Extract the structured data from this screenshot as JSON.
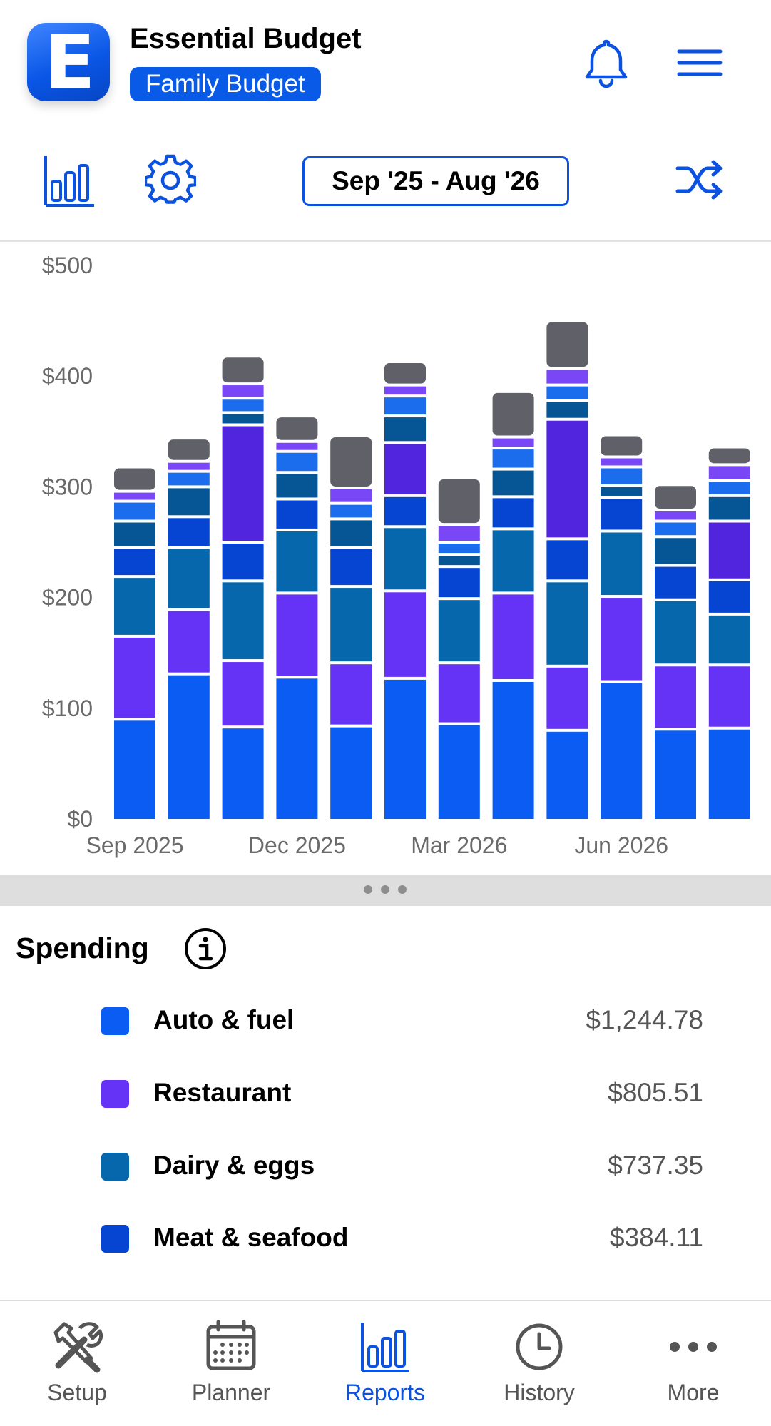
{
  "app": {
    "title": "Essential Budget",
    "logo_letter": "E",
    "budget_name": "Family Budget"
  },
  "toolbar": {
    "date_range": "Sep '25 - Aug '26"
  },
  "colors": {
    "brand": "#0a5ae8",
    "auto_fuel": "#0a5cf2",
    "restaurant": "#6533f6",
    "dairy_eggs": "#0767ad",
    "meat_seafood": "#0645d1",
    "other_grey": "#606068"
  },
  "chart_data": {
    "type": "bar",
    "stacked": true,
    "categories": [
      "Sep 2025",
      "Oct 2025",
      "Nov 2025",
      "Dec 2025",
      "Jan 2026",
      "Feb 2026",
      "Mar 2026",
      "Apr 2026",
      "May 2026",
      "Jun 2026",
      "Jul 2026",
      "Aug 2026"
    ],
    "x_tick_labels": [
      "Sep 2025",
      "Dec 2025",
      "Mar 2026",
      "Jun 2026"
    ],
    "y_tick_labels": [
      "$0",
      "$100",
      "$200",
      "$300",
      "$400",
      "$500"
    ],
    "ylim": [
      0,
      500
    ],
    "series": [
      {
        "name": "Auto & fuel",
        "color": "#0a5cf2",
        "values": [
          90,
          131,
          83,
          128,
          84,
          127,
          86,
          125,
          80,
          124,
          81,
          82
        ]
      },
      {
        "name": "Restaurant",
        "color": "#6533f6",
        "values": [
          75,
          58,
          60,
          76,
          57,
          79,
          55,
          79,
          58,
          77,
          58,
          57
        ]
      },
      {
        "name": "Dairy & eggs",
        "color": "#0767ad",
        "values": [
          54,
          56,
          72,
          57,
          69,
          58,
          58,
          58,
          77,
          59,
          59,
          46
        ]
      },
      {
        "name": "Meat & seafood",
        "color": "#0645d1",
        "values": [
          26,
          28,
          35,
          28,
          35,
          28,
          29,
          29,
          38,
          30,
          31,
          31
        ]
      },
      {
        "values": [
          0,
          0,
          106,
          0,
          0,
          48,
          0,
          0,
          108,
          0,
          0,
          53
        ]
      },
      {
        "values": [
          24,
          27,
          11,
          24,
          26,
          24,
          11,
          25,
          17,
          11,
          26,
          23
        ]
      },
      {
        "values": [
          18,
          14,
          13,
          19,
          14,
          18,
          11,
          19,
          14,
          17,
          14,
          14
        ]
      },
      {
        "values": [
          9,
          9,
          13,
          9,
          14,
          10,
          16,
          10,
          15,
          9,
          10,
          14
        ]
      },
      {
        "values": [
          22,
          21,
          25,
          23,
          47,
          21,
          42,
          41,
          43,
          20,
          23,
          16
        ]
      }
    ]
  },
  "spending": {
    "title": "Spending",
    "items": [
      {
        "name": "Auto & fuel",
        "amount": "$1,244.78",
        "color": "#0a5cf2"
      },
      {
        "name": "Restaurant",
        "amount": "$805.51",
        "color": "#6533f6"
      },
      {
        "name": "Dairy & eggs",
        "amount": "$737.35",
        "color": "#0767ad"
      },
      {
        "name": "Meat & seafood",
        "amount": "$384.11",
        "color": "#0645d1"
      }
    ]
  },
  "nav": [
    {
      "label": "Setup",
      "icon": "tools-icon"
    },
    {
      "label": "Planner",
      "icon": "calendar-icon"
    },
    {
      "label": "Reports",
      "icon": "bar-chart-icon",
      "active": true
    },
    {
      "label": "History",
      "icon": "clock-icon"
    },
    {
      "label": "More",
      "icon": "more-dots-icon"
    }
  ]
}
